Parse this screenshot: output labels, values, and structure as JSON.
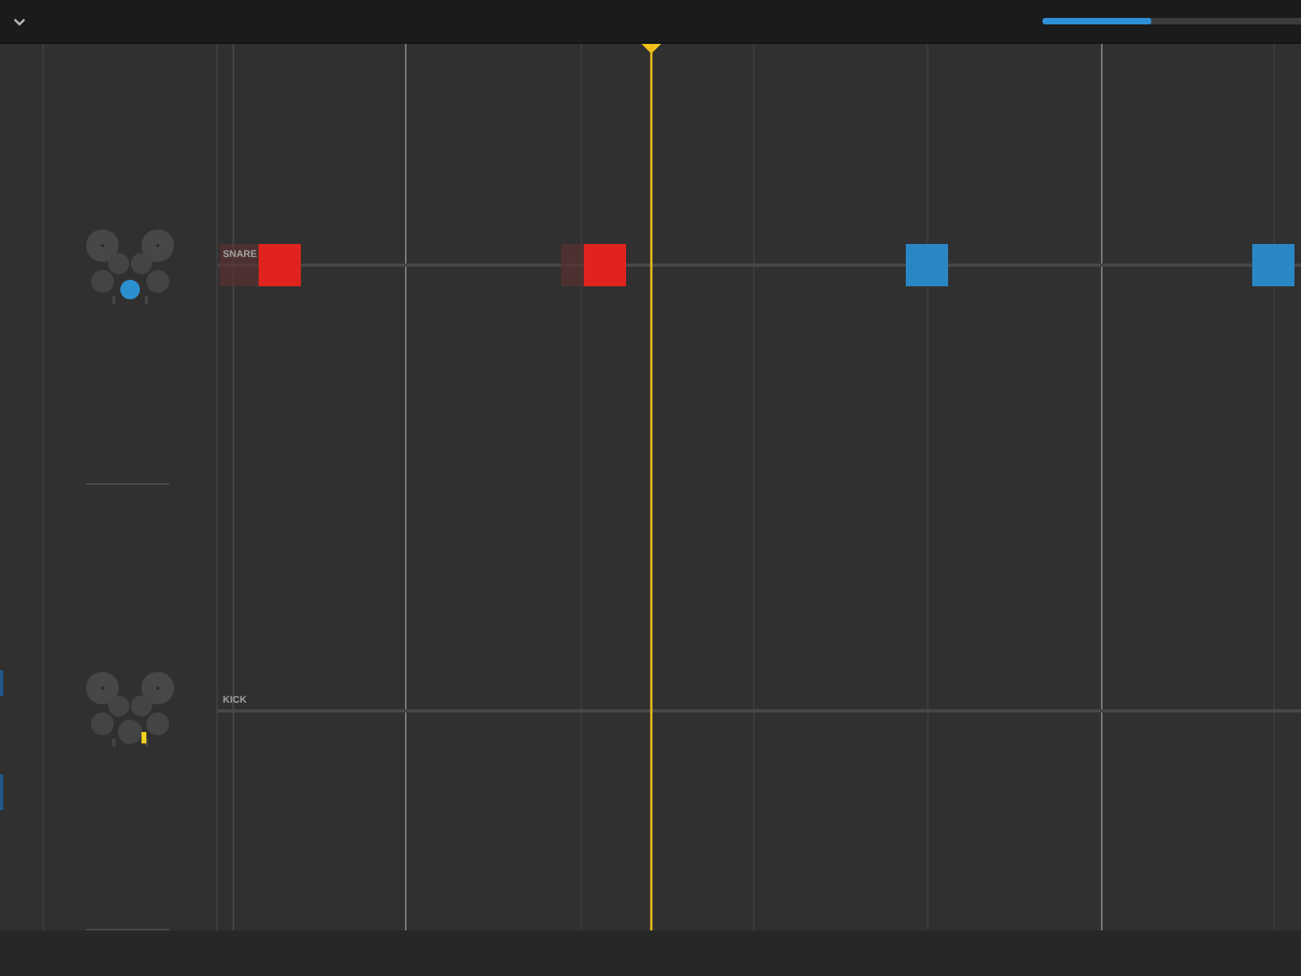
{
  "toolbar": {
    "progress": {
      "level": 0.42
    }
  },
  "lanes": [
    {
      "kind": "snare",
      "label": "SNARE",
      "notes": [
        {
          "played": true
        },
        {
          "played": true
        },
        {
          "played": false
        },
        {
          "played": false
        }
      ]
    },
    {
      "kind": "kick",
      "label": "KICK"
    }
  ]
}
